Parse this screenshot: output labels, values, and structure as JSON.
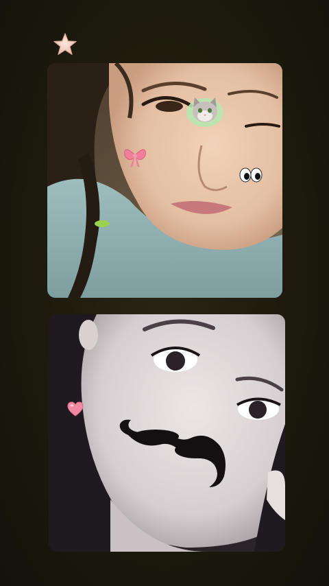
{
  "screen": {
    "background_color": "#1f1c0f"
  },
  "decorations": {
    "star_icon": "star-icon",
    "star_color": "#f3d3c8"
  },
  "photos": [
    {
      "name": "photo-top",
      "stickers": [
        "cat-icon",
        "bow-icon",
        "eyes-icon"
      ],
      "colors": {
        "skin": "#e6c3a8",
        "sweater": "#8fb0b2",
        "hair": "#2a2016",
        "bow": "#ef7f9a"
      }
    },
    {
      "name": "photo-bottom",
      "stickers": [
        "heart-icon",
        "mustache-icon"
      ],
      "colors": {
        "skin": "#d9d2d4",
        "hair": "#1f1a20",
        "heart": "#f08aa3",
        "mustache": "#141011"
      }
    }
  ]
}
